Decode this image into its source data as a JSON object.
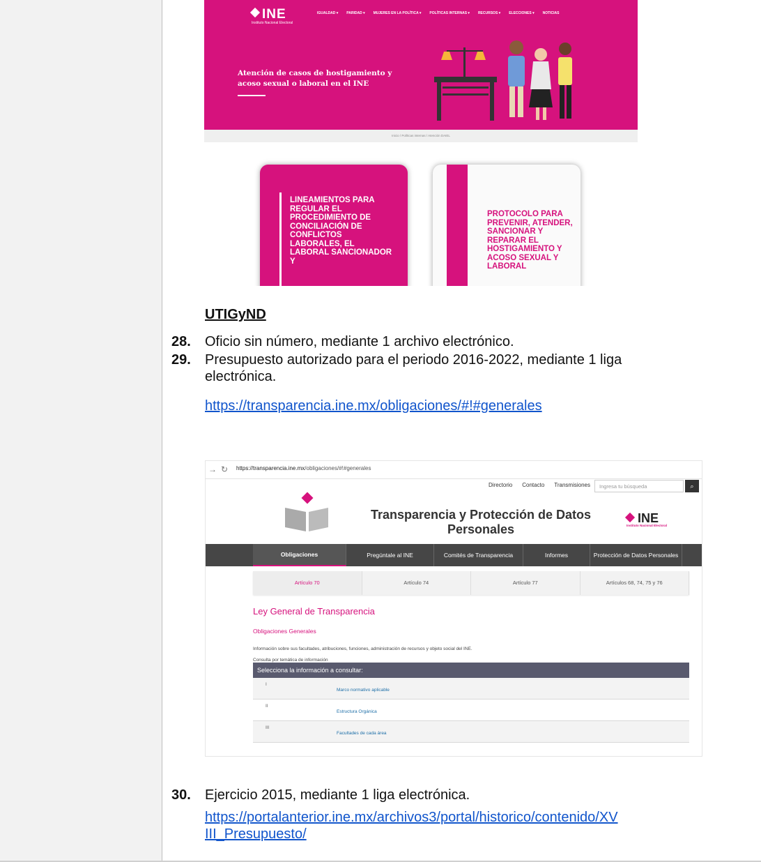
{
  "ine_page": {
    "logo": "INE",
    "logo_caption": "Instituto Nacional Electoral",
    "nav": [
      "IGUALDAD ▾",
      "PARIDAD ▾",
      "MUJERES EN LA POLÍTICA ▾",
      "POLÍTICAS INTERNAS ▾",
      "RECURSOS ▾",
      "ELECCIONES ▾",
      "NOTICIAS"
    ],
    "hero_title": "Atención de casos de hostigamiento y acoso sexual o laboral en el INE",
    "breadcrumb": "Inicio / Políticas internas / Atención DAIEL",
    "card_left": "LINEAMIENTOS PARA REGULAR EL PROCEDIMIENTO DE CONCILIACIÓN DE CONFLICTOS LABORALES, EL LABORAL SANCIONADOR Y",
    "card_right": "PROTOCOLO PARA PREVENIR, ATENDER, SANCIONAR Y REPARAR EL HOSTIGAMIENTO Y ACOSO SEXUAL Y LABORAL",
    "colors": {
      "brand": "#d6127d"
    }
  },
  "doc": {
    "heading": "UTIGyND",
    "item28_num": "28.",
    "item28_text": "Oficio sin número, mediante 1 archivo electrónico.",
    "item29_num": "29.",
    "item29_line1": "Presupuesto autorizado para el periodo 2016-2022, mediante 1 liga",
    "item29_line2": "electrónica.",
    "link1": "https://transparencia.ine.mx/obligaciones/#!#generales",
    "item30_num": "30.",
    "item30_text": "Ejercicio 2015, mediante 1 liga electrónica.",
    "link2_line1": "https://portalanterior.ine.mx/archivos3/portal/historico/contenido/XV",
    "link2_line2": "III_Presupuesto/"
  },
  "transparency_page": {
    "url_host": "https://transparencia.ine.mx",
    "url_path": "/obligaciones/#!#generales",
    "top_links": [
      "Directorio",
      "Contacto",
      "Transmisiones"
    ],
    "search_placeholder": "Ingresa tu búsqueda",
    "title": "Transparencia y Protección de Datos Personales",
    "logo": "INE",
    "logo_caption": "Instituto Nacional Electoral",
    "menu": [
      "Obligaciones",
      "Pregúntale al INE",
      "Comités de Transparencia",
      "Informes",
      "Protección de Datos Personales"
    ],
    "subtabs": [
      "Artículo 70",
      "Artículo 74",
      "Artículo 77",
      "Artículos 68, 74, 75 y 76"
    ],
    "law_heading": "Ley General de Transparencia",
    "subheading": "Obligaciones Generales",
    "info_text": "Información sobre sus facultades, atribuciones, funciones, administración de recursos y objeto social del INE.",
    "consult_text": "Consulta por temática de información",
    "select_bar": "Selecciona la información a consultar:",
    "rows": [
      {
        "roman": "I",
        "label": "Marco normativo aplicable"
      },
      {
        "roman": "II",
        "label": "Estructura Orgánica"
      },
      {
        "roman": "III",
        "label": "Facultades de cada área"
      }
    ]
  }
}
